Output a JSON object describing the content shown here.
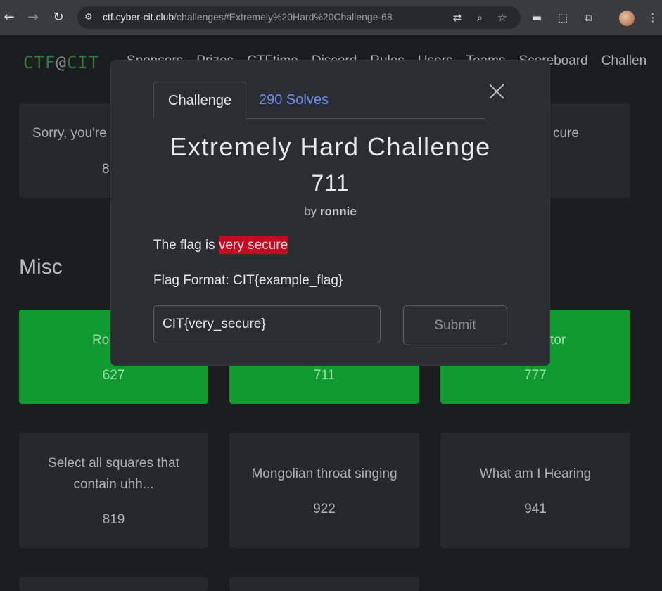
{
  "browser": {
    "url_host": "ctf.cyber-cit.club",
    "url_path": "/challenges#Extremely%20Hard%20Challenge-68"
  },
  "site": {
    "brand_left": "CTF",
    "brand_at": "@",
    "brand_right": "CIT",
    "nav": [
      "Sponsors",
      "Prizes",
      "CTFtime",
      "Discord",
      "Rules",
      "Users",
      "Teams",
      "Scoreboard",
      "Challen"
    ]
  },
  "cards_top": [
    {
      "title": "Sorry, you're",
      "value": "8"
    },
    {
      "title": "cure",
      "value": ""
    }
  ],
  "section_title": "Misc",
  "cards_misc_row1": [
    {
      "title": "Rol",
      "value": "627"
    },
    {
      "title": "",
      "value": "711"
    },
    {
      "title": "tor",
      "value": "777"
    }
  ],
  "cards_misc_row2": [
    {
      "title_line1": "Select all squares that",
      "title_line2": "contain uhh...",
      "value": "819"
    },
    {
      "title": "Mongolian throat singing",
      "value": "922"
    },
    {
      "title": "What am I Hearing",
      "value": "941"
    }
  ],
  "modal": {
    "tab_challenge": "Challenge",
    "tab_solves": "290 Solves",
    "title": "Extremely Hard Challenge",
    "value": "711",
    "by_prefix": "by",
    "author": "ronnie",
    "desc_prefix": "The flag is ",
    "desc_highlight": "very secure",
    "flag_format": "Flag Format: CIT{example_flag}",
    "input_value": "CIT{very_secure}",
    "submit_label": "Submit"
  },
  "colors": {
    "solved_green": "#119a2f",
    "highlight_red": "#c30b22",
    "link_blue": "#6f8ef0"
  }
}
